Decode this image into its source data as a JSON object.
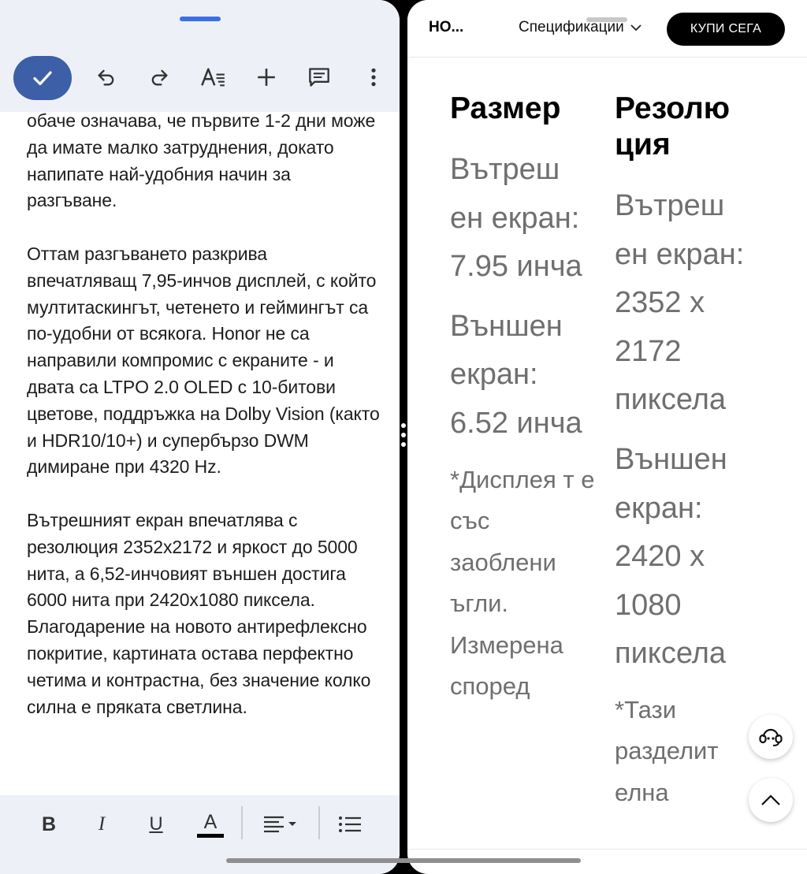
{
  "editor": {
    "toolbar": {
      "done": "check-icon",
      "undo": "undo-icon",
      "redo": "redo-icon",
      "text_format": "text-format-icon",
      "insert": "plus-icon",
      "comment": "comment-icon",
      "more": "more-vert-icon"
    },
    "paragraphs": [
      "обаче означава, че първите 1-2 дни може да имате малко затруднения, докато напипате най-удобния начин за разгъване.",
      "Оттам разгъването разкрива впечатляващ 7,95-инчов дисплей, с който мултитаскингът, четенето и геймингът са по-удобни от всякога. Honor не са направили компромис с екраните - и двата са LTPO 2.0 OLED с 10-битови цветове, поддръжка на Dolby Vision (както и HDR10/10+) и супербързо DWM димиране при 4320 Hz.",
      "Вътрешният екран впечатлява с резолюция 2352x2172 и яркост до 5000 нита, а 6,52-инчовият външен достига 6000 нита при 2420x1080 пиксела. Благодарение на новото антирефлексно покритие, картината остава перфектно четима и контрастна, без значение колко силна е пряката светлина."
    ],
    "format_bar": {
      "bold": "B",
      "italic": "I",
      "underline": "U",
      "text_color": "A",
      "align": "align-icon",
      "list": "list-icon",
      "accent_color": "#3d5fa8"
    }
  },
  "store": {
    "brand": "HO...",
    "specs_label": "Спецификации",
    "buy_label": "КУПИ СЕГА",
    "size_column": {
      "heading": "Размер",
      "values": [
        "Вътреш ен екран: 7.95 инча",
        "Външен екран: 6.52 инча"
      ],
      "note": "*Дисплея т е със заоблени ъгли. Измерена според"
    },
    "resolution_column": {
      "heading": "Резолю ция",
      "values": [
        "Вътреш ен екран: 2352 x 2172 пиксела",
        "Външен екран: 2420 x 1080 пиксела"
      ],
      "note": "*Тази разделит елна"
    },
    "support_icon": "headset-icon",
    "scroll_top_icon": "chevron-up-icon"
  }
}
